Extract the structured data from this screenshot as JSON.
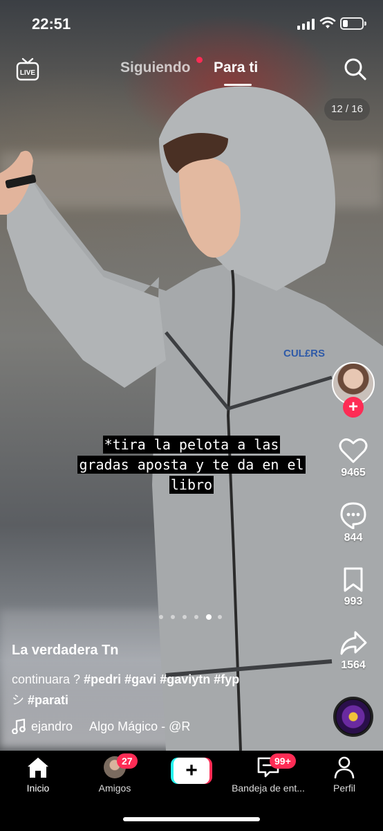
{
  "status_bar": {
    "time": "22:51",
    "battery_percent": 25
  },
  "top_nav": {
    "live_label": "LIVE",
    "tabs": [
      {
        "label": "Siguiendo",
        "active": false,
        "has_new_dot": true
      },
      {
        "label": "Para ti",
        "active": true
      }
    ]
  },
  "slide_counter": "12 / 16",
  "caption_lines": [
    "*tira la pelota a las",
    "gradas aposta y te da en el",
    "libro"
  ],
  "actions": {
    "likes": "9465",
    "comments": "844",
    "saves": "993",
    "shares": "1564"
  },
  "carousel": {
    "total_dots": 6,
    "active_index": 4
  },
  "post": {
    "username": "La verdadera Tn",
    "description_text": "continuara ?",
    "hashtags": [
      "#pedri",
      "#gavi",
      "#gaviytn",
      "#fyp"
    ],
    "description_line2_prefix": "シ",
    "description_line2_tag": "#parati",
    "music": "ejandro     Algo Mágico - @R"
  },
  "bottom_nav": {
    "items": [
      {
        "label": "Inicio",
        "icon": "home-icon",
        "active": true
      },
      {
        "label": "Amigos",
        "icon": "friends-avatar",
        "badge": "27"
      },
      {
        "label": "",
        "icon": "create-plus-icon"
      },
      {
        "label": "Bandeja de ent...",
        "icon": "inbox-icon",
        "badge": "99+"
      },
      {
        "label": "Perfil",
        "icon": "profile-icon"
      }
    ]
  },
  "colors": {
    "accent_red": "#fe2c55",
    "accent_cyan": "#25f4ee",
    "background": "#000000"
  }
}
